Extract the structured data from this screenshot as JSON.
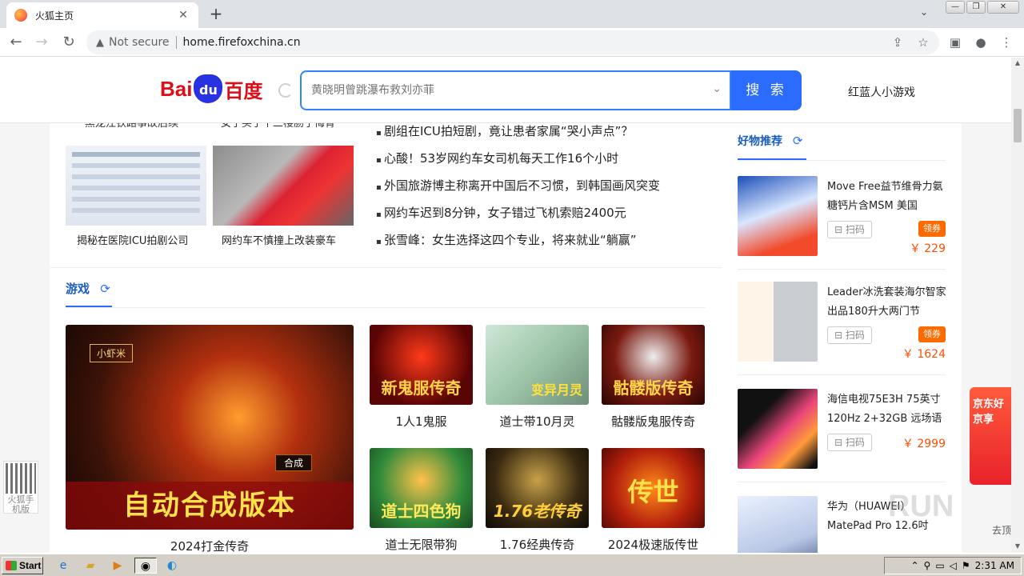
{
  "browser": {
    "tab_title": "火狐主页",
    "tab_close": "✕",
    "new_tab": "+",
    "tab_menu": "⌄",
    "security_label": "Not secure",
    "url": "home.firefoxchina.cn",
    "window_buttons": [
      "—",
      "❐",
      "✕"
    ]
  },
  "header": {
    "logo_bai": "Bai",
    "logo_du": "du",
    "logo_cn": "百度",
    "search_placeholder": "黄晓明曾跳瀑布救刘亦菲",
    "search_button": "搜 索",
    "hot_link": "红蓝人小游戏"
  },
  "news": {
    "cut_captions": [
      "黑龙江铁路事故后续",
      "女子买了个二楼肠子悔青"
    ],
    "image_captions": [
      "揭秘在医院ICU拍剧公司",
      "网约车不慎撞上改装豪车"
    ],
    "headlines": [
      "剧组在ICU拍短剧，竟让患者家属“哭小声点”？",
      "心酸！53岁网约车女司机每天工作16个小时",
      "外国旅游博主称离开中国后不习惯，到韩国画风突变",
      "网约车迟到8分钟，女子错过飞机索赔2400元",
      "张雪峰：女生选择这四个专业，将来就业“躺赢”"
    ]
  },
  "games": {
    "section_title": "游戏",
    "refresh_icon": "⟳",
    "featured": {
      "banner": "自动合成版本",
      "caption": "2024打金传奇",
      "tag": "合成",
      "badge": "小虾米"
    },
    "items": [
      {
        "label": "新鬼服传奇",
        "caption": "1人1鬼服"
      },
      {
        "label": "变异月灵",
        "caption": "道士带10月灵"
      },
      {
        "label": "骷髅版传奇",
        "caption": "骷髅版鬼服传奇"
      },
      {
        "label": "道士四色狗",
        "caption": "道士无限带狗"
      },
      {
        "label": "1.76老传奇",
        "caption": "1.76经典传奇"
      },
      {
        "label": "传世",
        "caption": "2024极速版传世"
      }
    ]
  },
  "sidebar": {
    "title": "好物推荐",
    "refresh_icon": "⟳",
    "scan_label": "⊟ 扫码",
    "coupon_label": "领券",
    "products": [
      {
        "name": "Move Free益节维骨力氨糖钙片含MSM 美国",
        "price": "￥ 229",
        "coupon": true
      },
      {
        "name": "Leader冰洗套装海尔智家出品180升大两门节",
        "price": "￥ 1624",
        "coupon": true
      },
      {
        "name": "海信电视75E3H 75英寸 120Hz 2+32GB 远场语",
        "price": "￥ 2999",
        "coupon": false
      },
      {
        "name": "华为（HUAWEI）MatePad Pro 12.6吋",
        "price": "",
        "coupon": false
      }
    ]
  },
  "floating": {
    "qr_text": "火狐手机版",
    "jd_text": "京东好京享",
    "go_back": "去顶",
    "watermark": "RUN"
  },
  "taskbar": {
    "start": "Start",
    "time": "2:31 AM"
  }
}
